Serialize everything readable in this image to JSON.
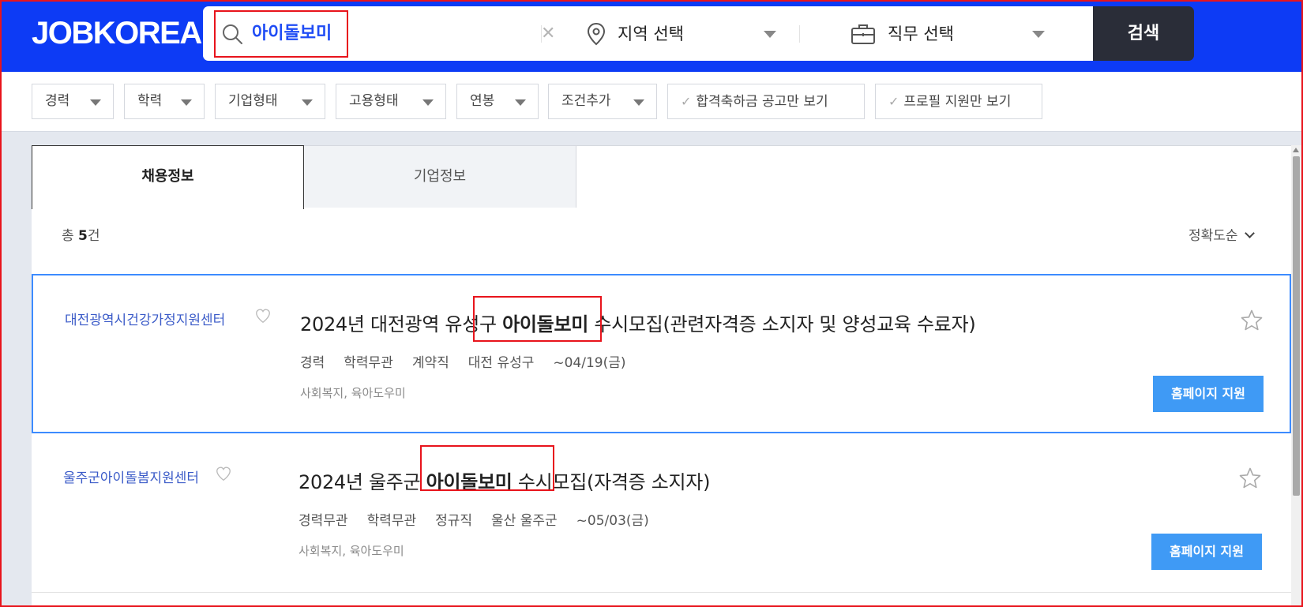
{
  "header": {
    "logo": "JOBKOREA",
    "search_keyword": "아이돌보미",
    "region_placeholder": "지역 선택",
    "job_placeholder": "직무 선택",
    "search_button": "검색"
  },
  "filters": {
    "career": "경력",
    "education": "학력",
    "company_type": "기업형태",
    "employment_type": "고용형태",
    "salary": "연봉",
    "add_condition": "조건추가",
    "bonus_only": "합격축하금 공고만 보기",
    "profile_only": "프로필 지원만 보기"
  },
  "tabs": {
    "jobs": "채용정보",
    "companies": "기업정보"
  },
  "results": {
    "total_prefix": "총",
    "total_count": "5",
    "total_suffix": "건",
    "sort": "정확도순"
  },
  "jobs": [
    {
      "company": "대전광역시건강가정지원센터",
      "title_before": "2024년 대전광역 유성구 ",
      "title_keyword": "아이돌보미",
      "title_after": " 수시모집(관련자격증 소지자 및 양성교육 수료자)",
      "career": "경력",
      "education": "학력무관",
      "employment": "계약직",
      "location": "대전 유성구",
      "deadline": "~04/19(금)",
      "tags": "사회복지, 육아도우미",
      "apply": "홈페이지 지원"
    },
    {
      "company": "울주군아이돌봄지원센터",
      "title_before": "2024년 울주군 ",
      "title_keyword": "아이돌보미",
      "title_after": " 수시모집(자격증 소지자)",
      "career": "경력무관",
      "education": "학력무관",
      "employment": "정규직",
      "location": "울산 울주군",
      "deadline": "~05/03(금)",
      "tags": "사회복지, 육아도우미",
      "apply": "홈페이지 지원"
    }
  ],
  "colors": {
    "brand_blue": "#0d3bf5",
    "apply_button": "#3f9af5",
    "highlight_red": "#e8141c",
    "company_link": "#3b5bc8"
  }
}
